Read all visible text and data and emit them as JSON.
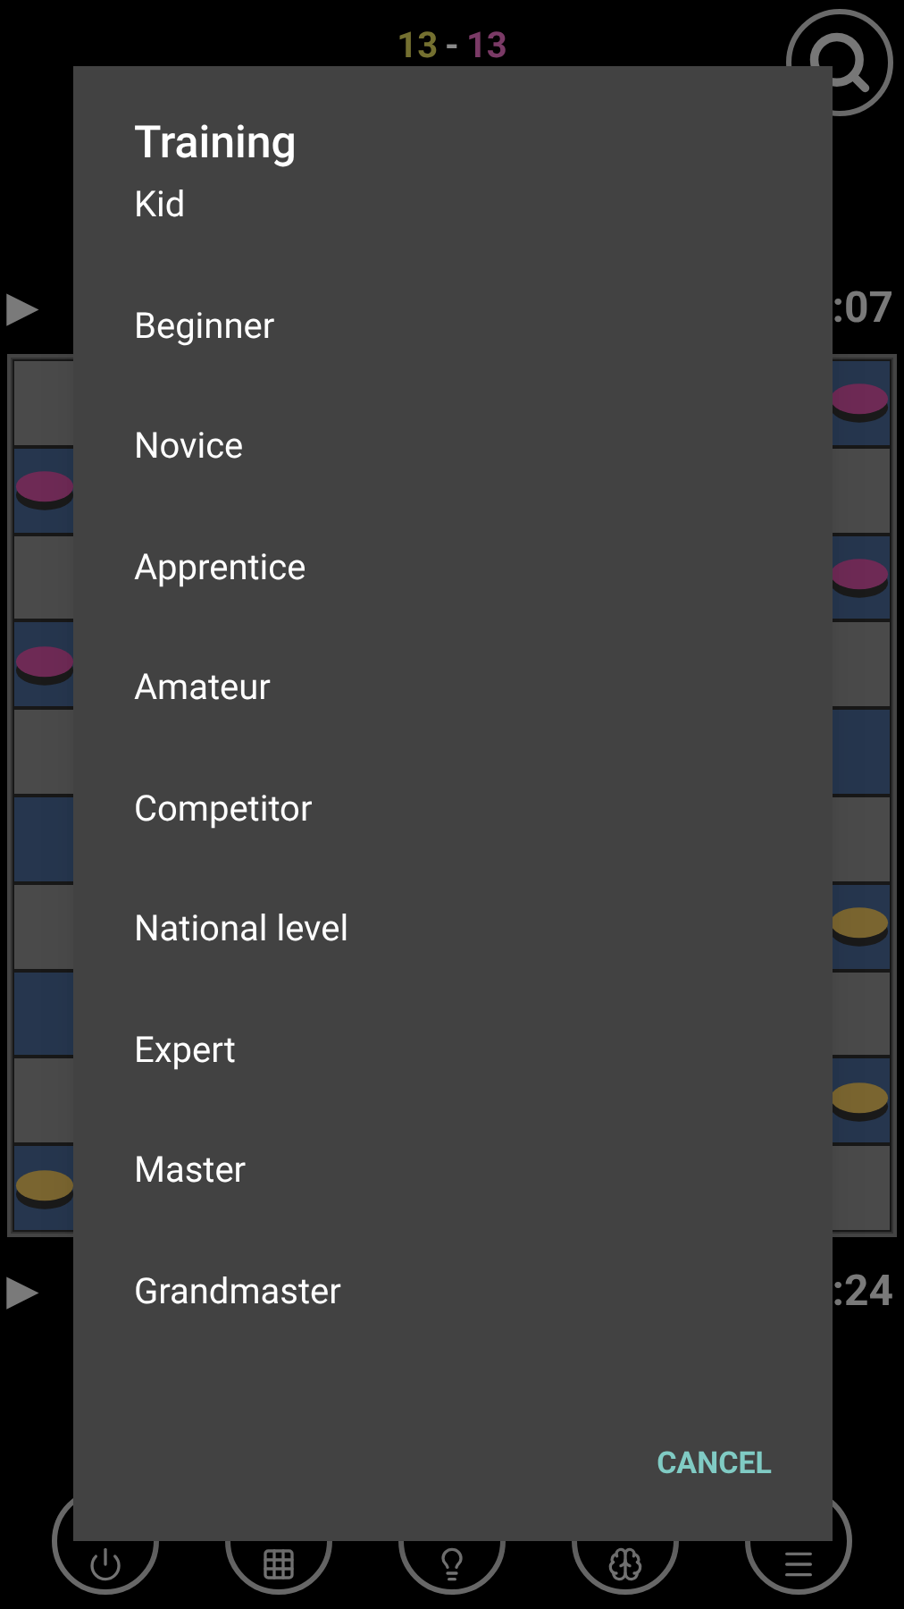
{
  "score": {
    "player_one": "13",
    "separator": "-",
    "player_two": "13"
  },
  "top_player": {
    "marker": "▶",
    "time": ":07"
  },
  "board": {
    "left_column": [
      {
        "piece": false
      },
      {
        "piece": true,
        "color": "#6e2a55"
      },
      {
        "piece": false
      },
      {
        "piece": true,
        "color": "#6e2a55"
      },
      {
        "piece": false
      },
      {
        "piece": false
      },
      {
        "piece": false
      },
      {
        "piece": false
      },
      {
        "piece": false
      },
      {
        "piece": true,
        "color": "#7a6530"
      }
    ],
    "right_column": [
      {
        "piece": true,
        "color": "#6e2a55"
      },
      {
        "piece": false
      },
      {
        "piece": true,
        "color": "#6e2a55"
      },
      {
        "piece": false
      },
      {
        "piece": false
      },
      {
        "piece": false
      },
      {
        "piece": true,
        "color": "#7a6530"
      },
      {
        "piece": false
      },
      {
        "piece": true,
        "color": "#7a6530"
      },
      {
        "piece": false
      }
    ]
  },
  "bottom_player": {
    "marker": "▶",
    "time": ":24"
  },
  "dialog": {
    "title": "Training",
    "items": [
      "Kid",
      "Beginner",
      "Novice",
      "Apprentice",
      "Amateur",
      "Competitor",
      "National level",
      "Expert",
      "Master",
      "Grandmaster"
    ],
    "cancel": "CANCEL"
  }
}
